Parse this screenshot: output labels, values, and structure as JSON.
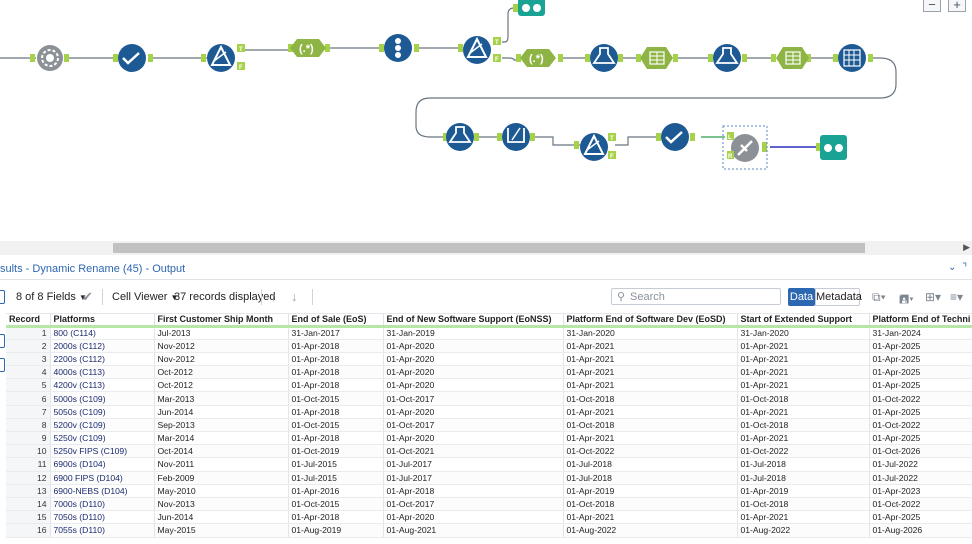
{
  "results": {
    "title": "sults - Dynamic Rename (45) - Output"
  },
  "toolbar": {
    "fields_label": "8 of 8 Fields",
    "cell_viewer_label": "Cell Viewer",
    "records_label": "37 records displayed",
    "search_placeholder": "Search",
    "data_tab": "Data",
    "metadata_tab": "Metadata"
  },
  "zoom": {
    "minus": "−",
    "plus": "+"
  },
  "table": {
    "columns": [
      "Record",
      "Platforms",
      "First Customer Ship Month",
      "End of Sale (EoS)",
      "End of New Software Support (EoNSS)",
      "Platform End of Software Dev (EoSD)",
      "Start of Extended Support",
      "Platform End of Techni"
    ],
    "rows": [
      [
        "1",
        "800 (C114)",
        "Jul-2013",
        "31-Jan-2017",
        "31-Jan-2019",
        "31-Jan-2020",
        "31-Jan-2020",
        "31-Jan-2024"
      ],
      [
        "2",
        "2000s (C112)",
        "Nov-2012",
        "01-Apr-2018",
        "01-Apr-2020",
        "01-Apr-2021",
        "01-Apr-2021",
        "01-Apr-2025"
      ],
      [
        "3",
        "2200s (C112)",
        "Nov-2012",
        "01-Apr-2018",
        "01-Apr-2020",
        "01-Apr-2021",
        "01-Apr-2021",
        "01-Apr-2025"
      ],
      [
        "4",
        "4000s (C113)",
        "Oct-2012",
        "01-Apr-2018",
        "01-Apr-2020",
        "01-Apr-2021",
        "01-Apr-2021",
        "01-Apr-2025"
      ],
      [
        "5",
        "4200v (C113)",
        "Oct-2012",
        "01-Apr-2018",
        "01-Apr-2020",
        "01-Apr-2021",
        "01-Apr-2021",
        "01-Apr-2025"
      ],
      [
        "6",
        "5000s (C109)",
        "Mar-2013",
        "01-Oct-2015",
        "01-Oct-2017",
        "01-Oct-2018",
        "01-Oct-2018",
        "01-Oct-2022"
      ],
      [
        "7",
        "5050s (C109)",
        "Jun-2014",
        "01-Apr-2018",
        "01-Apr-2020",
        "01-Apr-2021",
        "01-Apr-2021",
        "01-Apr-2025"
      ],
      [
        "8",
        "5200v (C109)",
        "Sep-2013",
        "01-Oct-2015",
        "01-Oct-2017",
        "01-Oct-2018",
        "01-Oct-2018",
        "01-Oct-2022"
      ],
      [
        "9",
        "5250v (C109)",
        "Mar-2014",
        "01-Apr-2018",
        "01-Apr-2020",
        "01-Apr-2021",
        "01-Apr-2021",
        "01-Apr-2025"
      ],
      [
        "10",
        "5250v FIPS (C109)",
        "Oct-2014",
        "01-Oct-2019",
        "01-Oct-2021",
        "01-Oct-2022",
        "01-Oct-2022",
        "01-Oct-2026"
      ],
      [
        "11",
        "6900s (D104)",
        "Nov-2011",
        "01-Jul-2015",
        "01-Jul-2017",
        "01-Jul-2018",
        "01-Jul-2018",
        "01-Jul-2022"
      ],
      [
        "12",
        "6900 FIPS (D104)",
        "Feb-2009",
        "01-Jul-2015",
        "01-Jul-2017",
        "01-Jul-2018",
        "01-Jul-2018",
        "01-Jul-2022"
      ],
      [
        "13",
        "6900-NEBS (D104)",
        "May-2010",
        "01-Apr-2016",
        "01-Apr-2018",
        "01-Apr-2019",
        "01-Apr-2019",
        "01-Apr-2023"
      ],
      [
        "14",
        "7000s (D110)",
        "Nov-2013",
        "01-Oct-2015",
        "01-Oct-2017",
        "01-Oct-2018",
        "01-Oct-2018",
        "01-Oct-2022"
      ],
      [
        "15",
        "7050s (D110)",
        "Jun-2014",
        "01-Apr-2018",
        "01-Apr-2020",
        "01-Apr-2021",
        "01-Apr-2021",
        "01-Apr-2025"
      ],
      [
        "16",
        "7055s (D110)",
        "May-2015",
        "01-Aug-2019",
        "01-Aug-2021",
        "01-Aug-2022",
        "01-Aug-2022",
        "01-Aug-2026"
      ]
    ]
  },
  "colors": {
    "accent": "#2c67b1",
    "tool_dark": "#1d5a93",
    "tool_green": "#8fb446",
    "tool_teal": "#1aa394",
    "tool_gray": "#8b9196"
  }
}
